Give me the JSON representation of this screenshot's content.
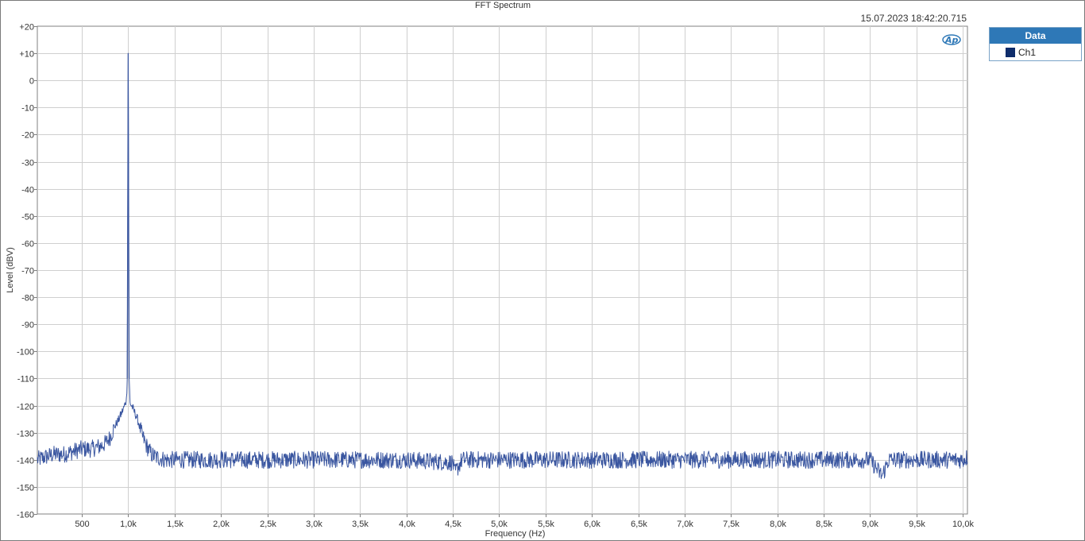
{
  "title": "FFT Spectrum",
  "timestamp": "15.07.2023 18:42:20.715",
  "logo": "ap-logo",
  "legend": {
    "header": "Data",
    "items": [
      {
        "label": "Ch1",
        "color": "#0f2d6b"
      }
    ]
  },
  "colors": {
    "trace": "#3a56a0",
    "grid": "#cfcfcf",
    "axis": "#808080"
  },
  "chart_data": {
    "type": "line",
    "title": "FFT Spectrum",
    "xlabel": "Frequency (Hz)",
    "ylabel": "Level (dBV)",
    "xlim": [
      20,
      10050
    ],
    "ylim": [
      -160,
      20
    ],
    "grid": true,
    "legend_position": "top-right, outside plot",
    "x_ticks": [
      500,
      1000,
      1500,
      2000,
      2500,
      3000,
      3500,
      4000,
      4500,
      5000,
      5500,
      6000,
      6500,
      7000,
      7500,
      8000,
      8500,
      9000,
      9500,
      10000
    ],
    "x_tick_labels": [
      "500",
      "1,0k",
      "1,5k",
      "2,0k",
      "2,5k",
      "3,0k",
      "3,5k",
      "4,0k",
      "4,5k",
      "5,0k",
      "5,5k",
      "6,0k",
      "6,5k",
      "7,0k",
      "7,5k",
      "8,0k",
      "8,5k",
      "9,0k",
      "9,5k",
      "10,0k"
    ],
    "y_ticks": [
      20,
      10,
      0,
      -10,
      -20,
      -30,
      -40,
      -50,
      -60,
      -70,
      -80,
      -90,
      -100,
      -110,
      -120,
      -130,
      -140,
      -150,
      -160
    ],
    "y_tick_labels": [
      "+20",
      "+10",
      "0",
      "-10",
      "-20",
      "-30",
      "-40",
      "-50",
      "-60",
      "-70",
      "-80",
      "-90",
      "-100",
      "-110",
      "-120",
      "-130",
      "-140",
      "-150",
      "-160"
    ],
    "series": [
      {
        "name": "Ch1",
        "x": [
          20,
          100,
          200,
          300,
          400,
          500,
          600,
          700,
          750,
          800,
          850,
          900,
          950,
          980,
          990,
          995,
          1000,
          1005,
          1010,
          1020,
          1050,
          1100,
          1150,
          1200,
          1250,
          1300,
          1400,
          1500,
          1600,
          1800,
          2000,
          2005,
          2010,
          2200,
          2500,
          3000,
          3500,
          4000,
          4500,
          4520,
          4600,
          5000,
          5500,
          6000,
          6500,
          7000,
          7500,
          8000,
          8500,
          8800,
          9000,
          9130,
          9200,
          9500,
          10000,
          10050
        ],
        "y": [
          -140,
          -139,
          -138,
          -138,
          -137,
          -136,
          -136,
          -135,
          -134,
          -132,
          -128,
          -125,
          -121,
          -118,
          -110,
          -60,
          10,
          -60,
          -110,
          -119,
          -121,
          -125,
          -131,
          -135,
          -138,
          -139,
          -140,
          -140,
          -140,
          -140,
          -140,
          -134,
          -140,
          -140,
          -140,
          -140,
          -140,
          -140,
          -141,
          -145,
          -140,
          -140,
          -140,
          -140,
          -140,
          -140,
          -140,
          -140,
          -140,
          -140,
          -140,
          -146,
          -140,
          -140,
          -140,
          -139
        ]
      }
    ]
  }
}
